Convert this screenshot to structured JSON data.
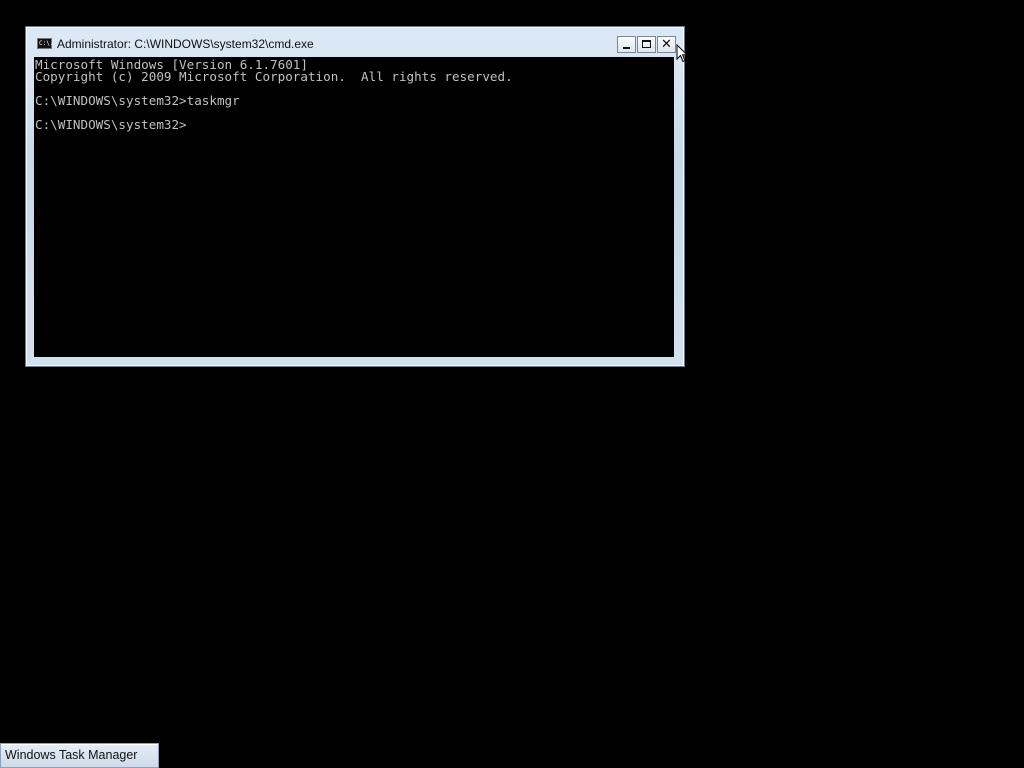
{
  "window": {
    "title": "Administrator: C:\\WINDOWS\\system32\\cmd.exe",
    "icon": "cmd-icon",
    "icon_text": "C:\\.",
    "controls": {
      "minimize": "minimize-icon",
      "maximize": "maximize-icon",
      "close": "close-icon",
      "close_glyph": "✕"
    }
  },
  "console": {
    "lines": [
      "Microsoft Windows [Version 6.1.7601]",
      "Copyright (c) 2009 Microsoft Corporation.  All rights reserved.",
      "",
      "C:\\WINDOWS\\system32>taskmgr",
      "",
      "C:\\WINDOWS\\system32>"
    ],
    "text_color": "#c0c0c0",
    "background_color": "#000000"
  },
  "taskbar": {
    "items": [
      {
        "label": "Windows Task Manager"
      }
    ]
  },
  "colors": {
    "desktop": "#000000",
    "window_frame": "#c9d9ea"
  },
  "cursor": "arrow-cursor-icon"
}
